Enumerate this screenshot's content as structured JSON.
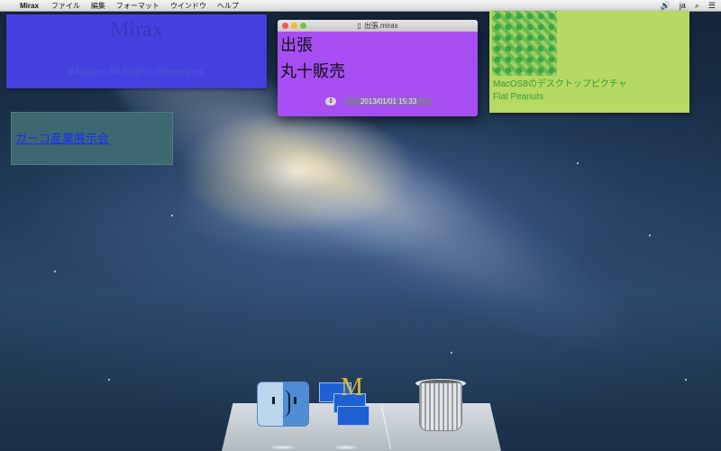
{
  "menubar": {
    "app_name": "Mirax",
    "items": [
      "ファイル",
      "編集",
      "フォーマット",
      "ウインドウ",
      "ヘルプ"
    ],
    "input_source": "ja"
  },
  "notes": {
    "blue": {
      "title": "Mirax",
      "footer": "iMappie All Rights Reserved.",
      "color": "#4540e0"
    },
    "teal": {
      "link": "ガーコ産業展示会",
      "color": "#3f6b73"
    },
    "green": {
      "line1": "MacOS8のデスクトップピクチャ",
      "line2": "Flat Peanuts",
      "color": "#b5d962"
    }
  },
  "window": {
    "title": "出張.mirax",
    "line1": "出張",
    "line2": "丸十販売",
    "date": "2013/01/01 15:33",
    "color": "#a64ef2"
  },
  "dock": {
    "items": [
      "finder-icon",
      "mirax-app-icon",
      "trash-icon"
    ]
  }
}
